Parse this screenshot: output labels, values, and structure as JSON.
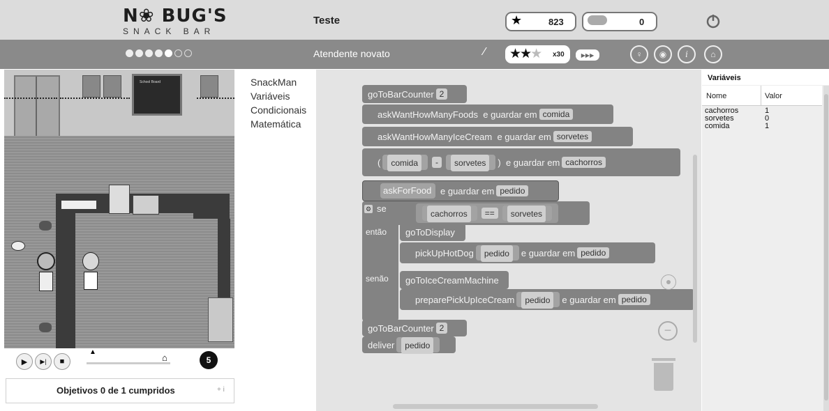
{
  "header": {
    "logo_main": "N❀ BUG'S",
    "logo_sub": "SNACK BAR",
    "title": "Teste",
    "stars_value": "823",
    "coins_value": "0",
    "rank": "Atendente novato",
    "star_rating": 2.5,
    "multiplier": "x30",
    "progress_dots": {
      "filled": 5,
      "total": 7
    }
  },
  "categories": [
    "SnackMan",
    "Variáveis",
    "Condicionais",
    "Matemática"
  ],
  "blocks": {
    "b1": "goToBarCounter",
    "b1_num": "2",
    "b2": "askWantHowManyFoods",
    "b2_store": "e guardar em",
    "b2_var": "comida",
    "b3": "askWantHowManyIceCream",
    "b3_store": "e guardar em",
    "b3_var": "sorvetes",
    "b4_open": "(",
    "b4_a": "comida",
    "b4_op": "-",
    "b4_b": "sorvetes",
    "b4_close": ")",
    "b4_store": "e guardar em",
    "b4_var": "cachorros",
    "b5": "askForFood",
    "b5_store": "e guardar em",
    "b5_var": "pedido",
    "if_label": "se",
    "if_a": "cachorros",
    "if_op": "==",
    "if_b": "sorvetes",
    "then_label": "então",
    "then_1": "goToDisplay",
    "then_2": "pickUpHotDog",
    "then_2_arg": "pedido",
    "then_2_store": "e guardar em",
    "then_2_var": "pedido",
    "else_label": "senão",
    "else_1": "goToIceCreamMachine",
    "else_2": "preparePickUpIceCream",
    "else_2_arg": "pedido",
    "else_2_store": "e guardar em",
    "else_2_var": "pedido",
    "b9": "goToBarCounter",
    "b9_num": "2",
    "b10": "deliver",
    "b10_var": "pedido"
  },
  "variables_panel": {
    "title": "Variáveis",
    "col_name": "Nome",
    "col_value": "Valor",
    "rows": [
      {
        "name": "cachorros",
        "value": "1"
      },
      {
        "name": "sorvetes",
        "value": "0"
      },
      {
        "name": "comida",
        "value": "1"
      }
    ]
  },
  "game": {
    "board_text": "School Board",
    "objectives": "Objetivos 0 de 1 cumpridos",
    "objectives_hint": "+ i",
    "speed_label": "5"
  },
  "icons": [
    "star-icon",
    "coin-icon",
    "power-icon",
    "wand-icon",
    "fast-forward-icon",
    "lightbulb-icon",
    "shield-icon",
    "info-icon",
    "home-icon",
    "play-icon",
    "step-icon",
    "stop-icon",
    "turtle-icon",
    "rabbit-icon",
    "trash-icon",
    "target-icon",
    "zoom-out-icon",
    "gear-icon"
  ]
}
